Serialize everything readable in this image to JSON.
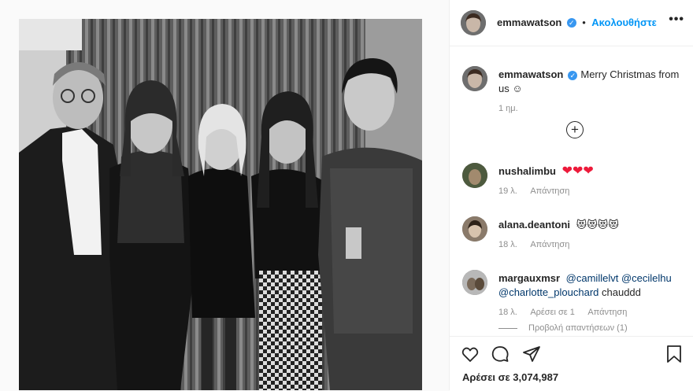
{
  "post": {
    "author": "emmawatson",
    "follow_label": "Ακολουθήστε",
    "more_label": "•••"
  },
  "caption": {
    "author": "emmawatson",
    "text": "Merry Christmas from us ☺",
    "age": "1 ημ."
  },
  "load_more_label": "+",
  "comments": [
    {
      "author": "nushalimbu",
      "text": "❤❤❤",
      "age": "19 λ.",
      "reply_label": "Απάντηση"
    },
    {
      "author": "alana.deantoni",
      "text": "😻😻😻😻",
      "age": "18 λ.",
      "reply_label": "Απάντηση"
    },
    {
      "author": "margauxmsr",
      "mentions": [
        "@camillelvt",
        "@cecilelhu",
        "@charlotte_plouchard"
      ],
      "text_after": "chauddd",
      "age": "18 λ.",
      "likes_label": "Αρέσει σε 1",
      "reply_label": "Απάντηση",
      "view_replies_label": "Προβολή απαντήσεων (1)"
    }
  ],
  "likes_label": "Αρέσει σε 3,074,987",
  "colors": {
    "accent": "#0095f6",
    "verified": "#3897f0",
    "heart": "#ed1a3a",
    "mention": "#00376b",
    "muted": "#8e8e8e"
  },
  "icons": {
    "like": "heart-outline-icon",
    "comment": "comment-bubble-icon",
    "share": "paper-plane-icon",
    "save": "bookmark-icon"
  }
}
